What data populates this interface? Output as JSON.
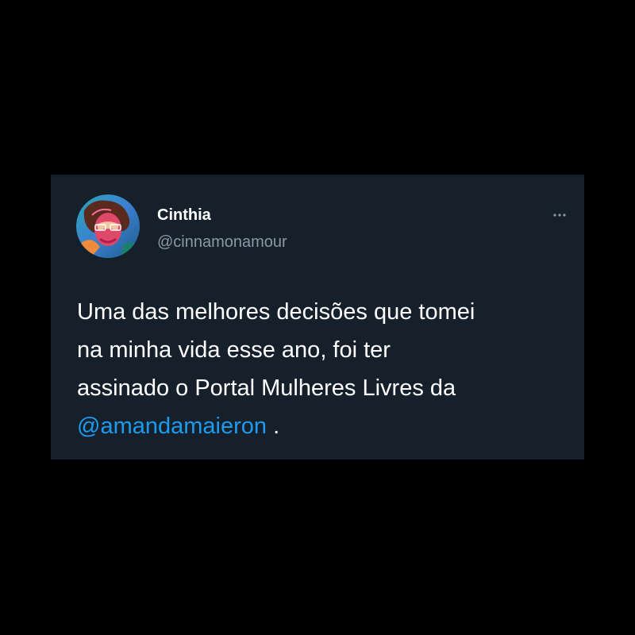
{
  "tweet": {
    "author": {
      "display_name": "Cinthia",
      "handle": "@cinnamonamour"
    },
    "text": {
      "line1": "Uma das melhores decisões que tomei",
      "line2": "na minha vida esse ano, foi ter",
      "line3": "assinado o Portal Mulheres Livres da",
      "mention": "@amandamaieron",
      "trailing": " ."
    },
    "icons": {
      "more": "more-horizontal-icon"
    }
  },
  "colors": {
    "page_background": "#000000",
    "card_background": "#15202b",
    "primary_text": "#ffffff",
    "secondary_text": "#8b98a5",
    "link": "#1d9bf0"
  }
}
